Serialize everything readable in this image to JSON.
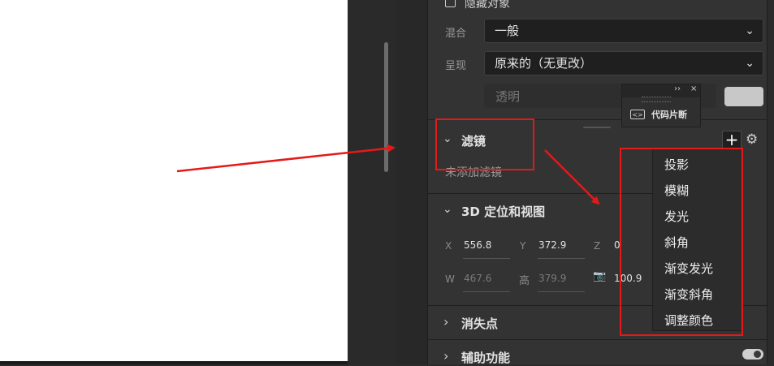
{
  "properties": {
    "hide_object_label": "隐藏对象",
    "blend_label": "混合",
    "blend_value": "一般",
    "render_label": "呈现",
    "render_value": "原来的（无更改）",
    "opacity_placeholder": "透明"
  },
  "snippet_popup": {
    "double_chevron": "››",
    "close": "×",
    "icon_glyph": "<>",
    "label": "代码片断"
  },
  "filters": {
    "title": "滤镜",
    "empty_text": "未添加滤镜",
    "add_symbol": "+",
    "gear_symbol": "⚙",
    "menu": [
      "投影",
      "模糊",
      "发光",
      "斜角",
      "渐变发光",
      "渐变斜角",
      "调整颜色"
    ]
  },
  "position3d": {
    "title": "3D 定位和视图",
    "x_label": "X",
    "x_value": "556.8",
    "y_label": "Y",
    "y_value": "372.9",
    "z_label": "Z",
    "z_value": "0",
    "w_label": "W",
    "w_value": "467.6",
    "h_label": "高",
    "h_value": "379.9",
    "camera_icon": "📷",
    "fov_value": "100.9"
  },
  "vanishing": {
    "title": "消失点"
  },
  "accessibility": {
    "title": "辅助功能"
  },
  "glyphs": {
    "chevron_down": "⌄",
    "chevron_right": "›",
    "expanded": "⌄"
  },
  "colors": {
    "annotation_red": "#e51919",
    "panel_bg": "#333333",
    "canvas_bg": "#ffffff"
  }
}
